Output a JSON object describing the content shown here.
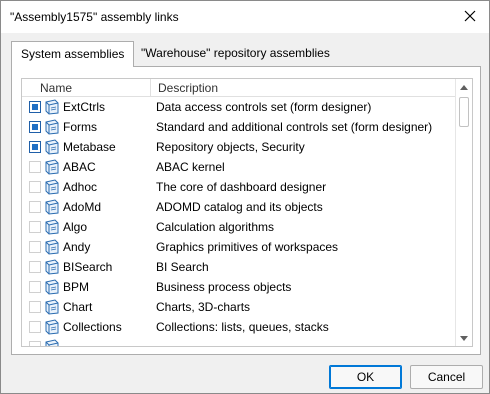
{
  "window": {
    "title": "\"Assembly1575\" assembly links"
  },
  "tabs": [
    {
      "label": "System assemblies",
      "active": true
    },
    {
      "label": "\"Warehouse\" repository assemblies",
      "active": false
    }
  ],
  "list": {
    "columns": {
      "name": "Name",
      "description": "Description"
    },
    "rows": [
      {
        "name": "ExtCtrls",
        "description": "Data access controls set (form designer)",
        "checked": true
      },
      {
        "name": "Forms",
        "description": "Standard and additional controls set (form designer)",
        "checked": true
      },
      {
        "name": "Metabase",
        "description": "Repository objects, Security",
        "checked": true
      },
      {
        "name": "ABAC",
        "description": "ABAC kernel",
        "checked": false
      },
      {
        "name": "Adhoc",
        "description": "The core of dashboard designer",
        "checked": false
      },
      {
        "name": "AdoMd",
        "description": "ADOMD catalog and its objects",
        "checked": false
      },
      {
        "name": "Algo",
        "description": "Calculation algorithms",
        "checked": false
      },
      {
        "name": "Andy",
        "description": "Graphics primitives of workspaces",
        "checked": false
      },
      {
        "name": "BISearch",
        "description": "BI Search",
        "checked": false
      },
      {
        "name": "BPM",
        "description": "Business process objects",
        "checked": false
      },
      {
        "name": "Chart",
        "description": "Charts, 3D-charts",
        "checked": false
      },
      {
        "name": "Collections",
        "description": "Collections: lists, queues, stacks",
        "checked": false
      },
      {
        "name": "",
        "description": "",
        "checked": false
      }
    ]
  },
  "buttons": {
    "ok": "OK",
    "cancel": "Cancel"
  },
  "colors": {
    "accent": "#0078d7",
    "check_fill": "#1f6fc4",
    "icon_blue": "#2b6cb0"
  },
  "icons": {
    "close": "close-icon",
    "assembly": "assembly-icon",
    "scroll_up": "scroll-up-arrow-icon",
    "scroll_down": "scroll-down-arrow-icon"
  }
}
